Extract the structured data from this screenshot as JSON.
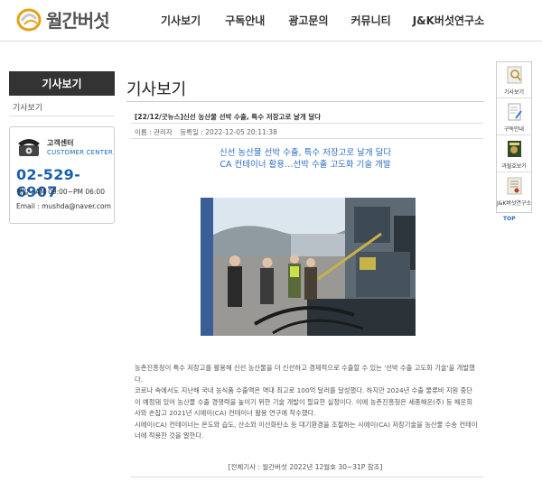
{
  "header": {
    "brand": "월간버섯",
    "nav": [
      "기사보기",
      "구독안내",
      "광고문의",
      "커뮤니티",
      "J&K버섯연구소"
    ]
  },
  "sidebar": {
    "title": "기사보기",
    "items": [
      "기사보기"
    ],
    "customer_center": {
      "title": "고객센터",
      "subtitle": "CUSTOMER CENTER",
      "tel": "02-529-6907",
      "hours": "평일 : AM 09:00~PM 06:00",
      "email": "Email : mushda@naver.com"
    }
  },
  "main": {
    "page_title": "기사보기",
    "article": {
      "title": "[22/12/굿뉴스]신선 농산물 선박 수출, 특수 저장고로 날개 달다",
      "author": "이름 : 관리자",
      "date": "등록일 : 2022-12-05 20:11:38",
      "headline_1": "신선 농산물 선박 수출, 특수 저장고로 날개 달다",
      "headline_2": "CA 컨테이너 활용…선박 수출 고도화 기술 개발",
      "paragraphs": [
        "농촌진흥청이 특수 저장고를 활용해 신선 농산물을 더 신선하고 경제적으로 수출할 수 있는 '선박 수출 고도화 기술'을 개발했다.",
        "코로나 속에서도 지난해 국내 농식품 수출액은 역대 최고로 100억 달러를 달성했다. 하지만 2024년 수출 물류비 지원 중단이 예정돼 있어 농산물 수출 경쟁력을 높이기 위한 기술 개발이 필요한 실정이다. 이에 농촌진흥청은 세종해운(주) 등 해운회사와 손잡고 2021년 시에이(CA) 컨테이너 활용 연구에 착수했다.",
        "시에이(CA) 컨테이너는 온도와 습도, 산소와 이산화탄소 등 대기환경을 조절하는 시에이(CA) 저장기술을 농산물 수송 컨테이너에 적용한 것을 말한다."
      ],
      "source": "[전체기사 : 월간버섯 2022년 12월호 30~31P 참조]"
    }
  },
  "quickbar": {
    "items": [
      "기사보기",
      "구독안내",
      "과월호보기",
      "J&K버섯연구소"
    ],
    "top": "TOP"
  },
  "colors": {
    "accent_blue": "#2f6fc4",
    "phone_blue": "#1a5fab",
    "dark": "#333333"
  }
}
